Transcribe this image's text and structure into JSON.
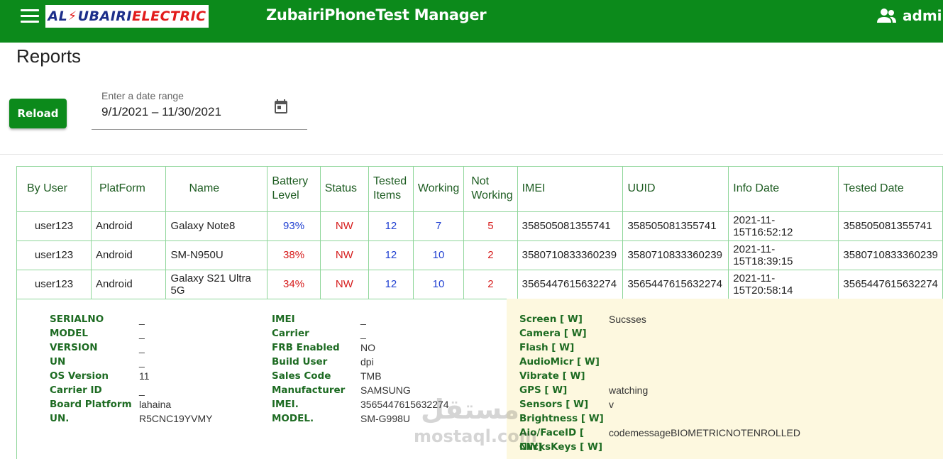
{
  "header": {
    "logo_left": "AL",
    "logo_mid": "UBAIRI",
    "logo_right": "ELECTRIC",
    "title": "ZubairiPhoneTest Manager",
    "user": "admin"
  },
  "page": {
    "title": "Reports"
  },
  "controls": {
    "reload_label": "Reload",
    "date_label": "Enter a date range",
    "date_value": "9/1/2021 – 11/30/2021"
  },
  "table": {
    "headers": [
      "By User",
      "PlatForm",
      "Name",
      "Battery Level",
      "Status",
      "Tested Items",
      "Working",
      "Not Working",
      "IMEI",
      "UUID",
      "Info Date",
      "Tested Date"
    ],
    "rows": [
      {
        "user": "user123",
        "platform": "Android",
        "name": "Galaxy Note8",
        "battery": "93%",
        "status": "NW",
        "tested": "12",
        "working": "7",
        "not_working": "5",
        "imei": "358505081355741",
        "uuid": "358505081355741",
        "info_date": "2021-11-15T16:52:12",
        "tested_date": "358505081355741"
      },
      {
        "user": "user123",
        "platform": "Android",
        "name": "SM-N950U",
        "battery": "38%",
        "status": "NW",
        "tested": "12",
        "working": "10",
        "not_working": "2",
        "imei": "3580710833360239",
        "uuid": "3580710833360239",
        "info_date": "2021-11-15T18:39:15",
        "tested_date": "3580710833360239"
      },
      {
        "user": "user123",
        "platform": "Android",
        "name": "Galaxy S21 Ultra 5G",
        "battery": "34%",
        "status": "NW",
        "tested": "12",
        "working": "10",
        "not_working": "2",
        "imei": "3565447615632274",
        "uuid": "3565447615632274",
        "info_date": "2021-11-15T20:58:14",
        "tested_date": "3565447615632274"
      }
    ]
  },
  "detail": {
    "col1": [
      {
        "k": "SERIALNO",
        "v": "_"
      },
      {
        "k": "MODEL",
        "v": "_"
      },
      {
        "k": "VERSION",
        "v": "_"
      },
      {
        "k": "UN",
        "v": "_"
      },
      {
        "k": "OS Version",
        "v": "11"
      },
      {
        "k": "Carrier ID",
        "v": "_"
      },
      {
        "k": "Board Platform",
        "v": "lahaina"
      },
      {
        "k": "UN.",
        "v": "R5CNC19YVMY"
      }
    ],
    "col2": [
      {
        "k": "IMEI",
        "v": "_"
      },
      {
        "k": "Carrier",
        "v": "_"
      },
      {
        "k": "FRB Enabled",
        "v": "NO"
      },
      {
        "k": "Build User",
        "v": "dpi"
      },
      {
        "k": "Sales Code",
        "v": "TMB"
      },
      {
        "k": "Manufacturer",
        "v": "SAMSUNG"
      },
      {
        "k": "IMEI.",
        "v": "3565447615632274"
      },
      {
        "k": "MODEL.",
        "v": "SM-G998U"
      }
    ],
    "col3": [
      {
        "k": "Screen [ W]",
        "v": "Sucsses"
      },
      {
        "k": "Camera [ W]",
        "v": ""
      },
      {
        "k": "Flash [ W]",
        "v": ""
      },
      {
        "k": "AudioMicr [ W]",
        "v": ""
      },
      {
        "k": "Vibrate [ W]",
        "v": ""
      },
      {
        "k": "GPS [ W]",
        "v": "watching"
      },
      {
        "k": "Sensors [ W]",
        "v": "v"
      },
      {
        "k": "Brightness [ W]",
        "v": ""
      },
      {
        "k": "Aio/FaceID [ NW]",
        "v": "codemessageBIOMETRICNOTENROLLED"
      },
      {
        "k": "ClicksKeys [ W]",
        "v": ""
      }
    ]
  },
  "watermark": {
    "arabic": "مستقل",
    "latin": "mostaql.com"
  },
  "colors": {
    "brand_green": "#0c8a1b",
    "label_green": "#1d6b22",
    "value_blue": "#1f3fd1",
    "value_red": "#d61d1d",
    "detail_bg": "#fdf8df"
  }
}
